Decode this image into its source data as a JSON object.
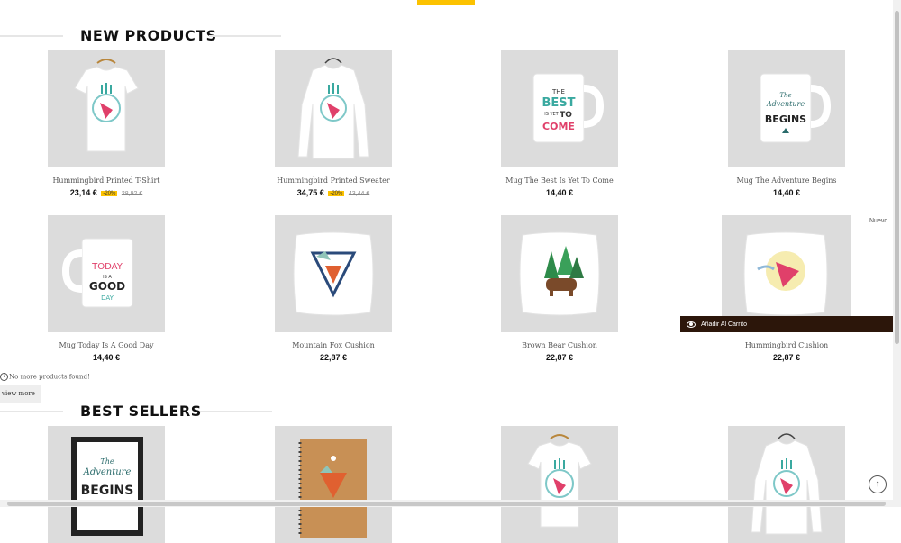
{
  "sections": {
    "new_products": {
      "title": "NEW PRODUCTS"
    },
    "best_sellers": {
      "title": "BEST SELLERS"
    }
  },
  "new_products": [
    {
      "name": "Hummingbird Printed T-Shirt",
      "price": "23,14 €",
      "discount": "-20%",
      "old_price": "28,92 €"
    },
    {
      "name": "Hummingbird Printed Sweater",
      "price": "34,75 €",
      "discount": "-20%",
      "old_price": "43,44 €"
    },
    {
      "name": "Mug The Best Is Yet To Come",
      "price": "14,40 €"
    },
    {
      "name": "Mug The Adventure Begins",
      "price": "14,40 €"
    },
    {
      "name": "Mug Today Is A Good Day",
      "price": "14,40 €"
    },
    {
      "name": "Mountain Fox Cushion",
      "price": "22,87 €"
    },
    {
      "name": "Brown Bear Cushion",
      "price": "22,87 €"
    },
    {
      "name": "Hummingbird Cushion",
      "price": "22,87 €"
    }
  ],
  "product_art": {
    "mug_best": [
      "THE",
      "BEST",
      "IS YET",
      "TO",
      "COME"
    ],
    "mug_adventure": [
      "The",
      "Adventure",
      "BEGINS"
    ],
    "mug_today": [
      "TODAY",
      "IS A",
      "GOOD",
      "DAY"
    ],
    "poster": [
      "The",
      "Adventure",
      "BEGINS"
    ]
  },
  "no_more_text": "No more products found!",
  "view_more_label": "view more",
  "badge_new": "Nuevo",
  "add_to_cart_label": "Añadir Al Carrito",
  "scroll_top_icon": "arrow-up-icon",
  "colors": {
    "accent": "#fcc200",
    "cart_bar": "#2c160a",
    "thumb_bg": "#dcdcdc"
  }
}
